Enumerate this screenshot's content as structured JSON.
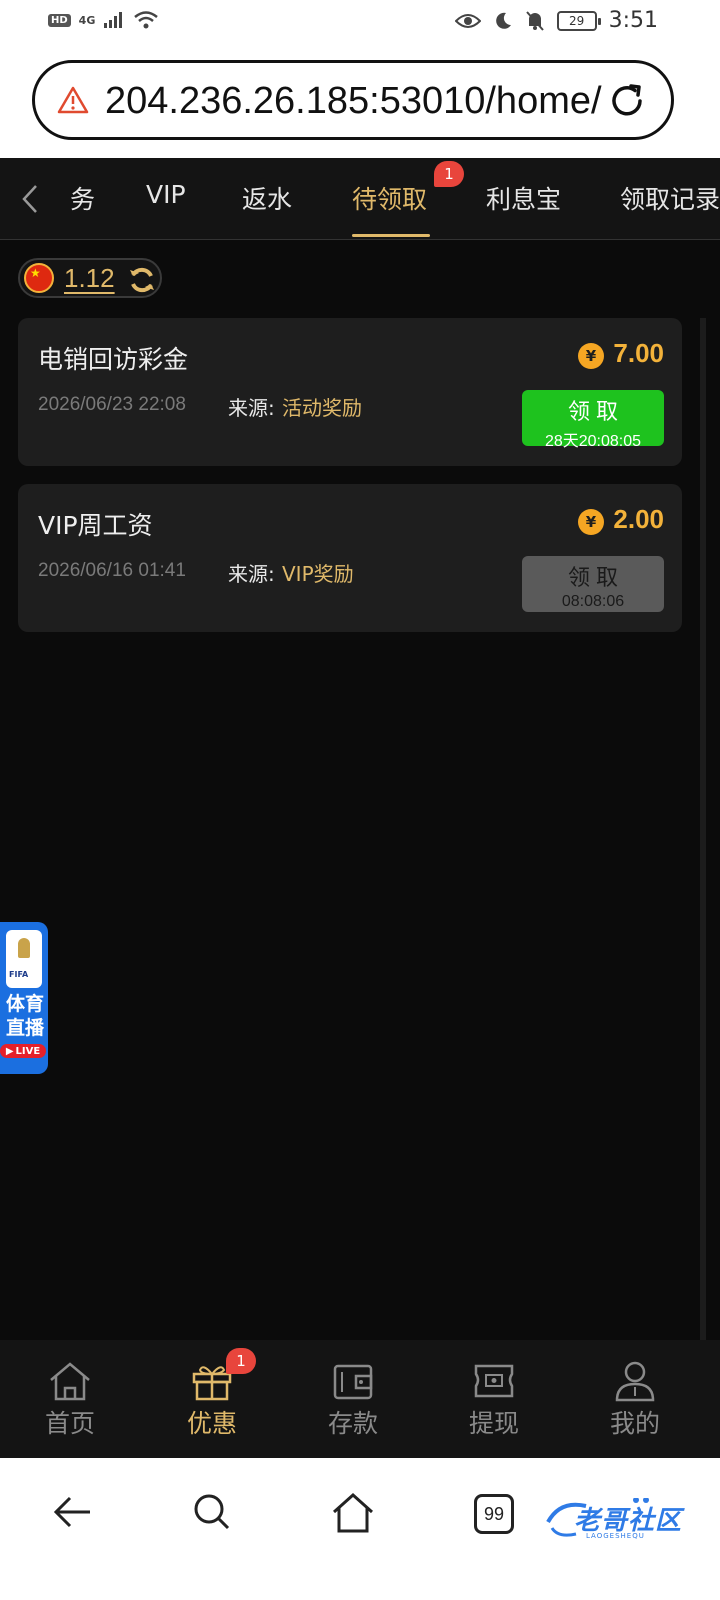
{
  "status_bar": {
    "hd": "HD",
    "network": "4G",
    "battery": "29",
    "time": "3:51"
  },
  "browser": {
    "url": "204.236.26.185:53010/home/"
  },
  "tabs": {
    "items": [
      {
        "label": "务"
      },
      {
        "label": "VIP"
      },
      {
        "label": "返水"
      },
      {
        "label": "待领取"
      },
      {
        "label": "利息宝"
      },
      {
        "label": "领取记录"
      }
    ],
    "active_index": 3,
    "badge": "1"
  },
  "balance": {
    "value": "1.12"
  },
  "cards": [
    {
      "title": "电销回访彩金",
      "date": "2026/06/23 22:08",
      "source_label": "来源:",
      "source_value": "活动奖励",
      "coin_symbol": "¥",
      "amount": "7.00",
      "button_label": "领取",
      "button_timer": "28天20:08:05",
      "button_state": "active"
    },
    {
      "title": "VIP周工资",
      "date": "2026/06/16 01:41",
      "source_label": "来源:",
      "source_value": "VIP奖励",
      "coin_symbol": "¥",
      "amount": "2.00",
      "button_label": "领取",
      "button_timer": "08:08:06",
      "button_state": "disabled"
    }
  ],
  "live_widget": {
    "fifa": "FIFA",
    "text_line1": "体育",
    "text_line2": "直播",
    "live": "LIVE"
  },
  "bottom_nav": {
    "items": [
      {
        "label": "首页",
        "icon": "home-icon"
      },
      {
        "label": "优惠",
        "icon": "gift-icon"
      },
      {
        "label": "存款",
        "icon": "wallet-icon"
      },
      {
        "label": "提现",
        "icon": "withdraw-icon"
      },
      {
        "label": "我的",
        "icon": "user-icon"
      }
    ],
    "active_index": 1,
    "badge": "1"
  },
  "system_nav": {
    "tab_count": "99",
    "watermark": "老哥社区",
    "watermark_sub": "LAOGESHEQU"
  },
  "colors": {
    "accent_gold": "#e0b96a",
    "claim_green": "#1ec21e",
    "badge_red": "#e8453c",
    "coin_orange": "#f5a623"
  }
}
